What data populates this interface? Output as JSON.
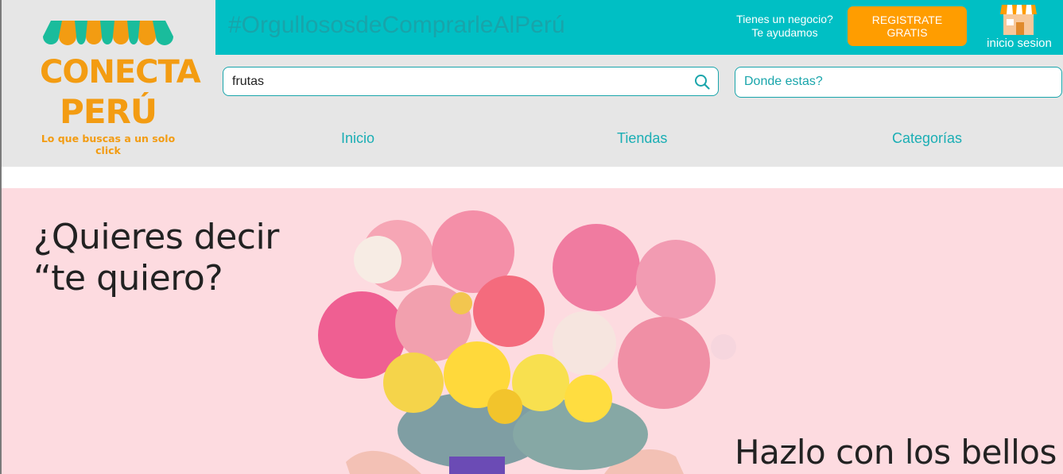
{
  "brand": {
    "line1": "CONECTA",
    "line2": "PERÚ",
    "tagline": "Lo que buscas a un solo click",
    "colors": {
      "orange": "#f39c12",
      "teal": "#00bfc4"
    }
  },
  "topbar": {
    "hashtag": "#OrgullososdeComprarleAlPerú",
    "help_line1": "Tienes un negocio?",
    "help_line2": "Te ayudamos",
    "register_line1": "REGISTRATE",
    "register_line2": "GRATIS",
    "login_label": "inicio sesion",
    "login_icon": "store-icon"
  },
  "search": {
    "value": "frutas",
    "icon": "search-icon"
  },
  "location": {
    "placeholder": "Donde estas?"
  },
  "nav": {
    "items": [
      "Inicio",
      "Tiendas",
      "Categorías"
    ]
  },
  "banner": {
    "headline_line1": "¿Quieres decir",
    "headline_line2": "“te quiero?",
    "subheadline": "Hazlo con los bellos",
    "background": "#fddbe0"
  }
}
